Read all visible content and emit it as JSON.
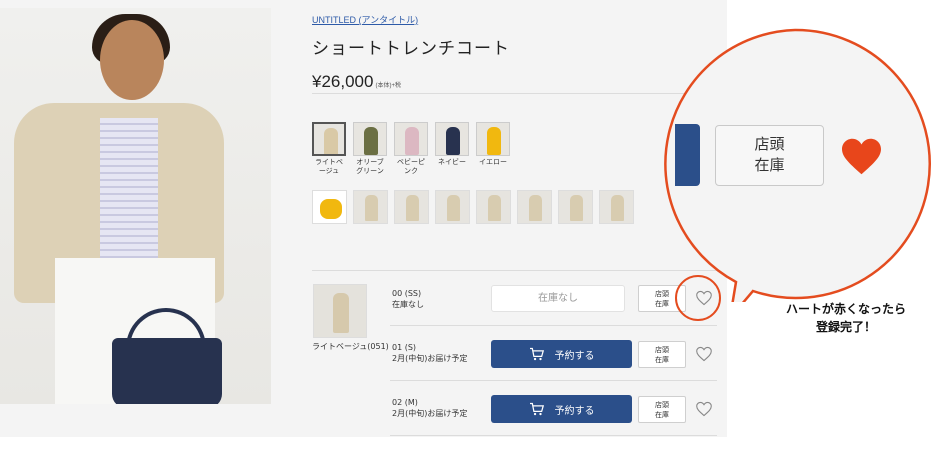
{
  "product": {
    "brand": "UNTITLED (アンタイトル)",
    "title": "ショートトレンチコート",
    "price": "¥26,000",
    "price_suffix": "(本体)+税"
  },
  "colors": [
    {
      "label": "ライトベージュ",
      "swatch": "#d9c9a6",
      "selected": true
    },
    {
      "label": "オリーブグリーン",
      "swatch": "#6b6f43"
    },
    {
      "label": "ベビーピンク",
      "swatch": "#dcb8c2"
    },
    {
      "label": "ネイビー",
      "swatch": "#28324f"
    },
    {
      "label": "イエロー",
      "swatch": "#f1b80f"
    }
  ],
  "sizes": [
    {
      "code": "00 (SS)",
      "status": "在庫なし",
      "action": "在庫なし",
      "available": false
    },
    {
      "code": "01 (S)",
      "status": "2月(中旬)お届け予定",
      "action": "予約する",
      "available": true
    },
    {
      "code": "02 (M)",
      "status": "2月(中旬)お届け予定",
      "action": "予約する",
      "available": true
    }
  ],
  "selected_color_label": "ライトベージュ(051)",
  "store_stock_label": "店頭在庫",
  "store_stock_line1": "店頭",
  "store_stock_line2": "在庫",
  "callout": {
    "line1": "ハートが赤くなったら",
    "line2": "登録完了！"
  },
  "colors_theme": {
    "accent_blue": "#2b4f8a",
    "heart_red": "#e8461b",
    "bubble_border": "#e44c1f"
  }
}
